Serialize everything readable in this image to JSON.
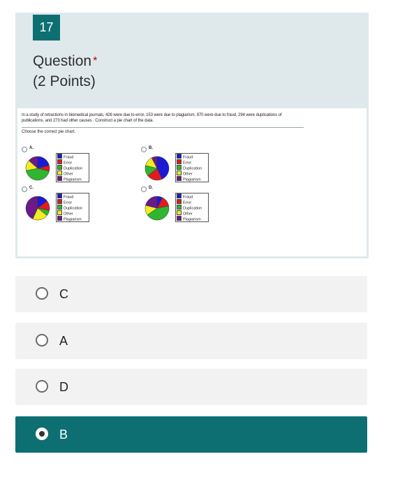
{
  "question": {
    "number": "17",
    "title": "Question",
    "required_mark": "*",
    "points": "(2 Points)"
  },
  "problem": {
    "text": "In a study of retractions in biomedical journals, 426 were due to error, 153 were due to plagiarism, 870 were due to fraud, 294 were duplications of publications, and 273 had other causes . Construct a pie chart of the data.",
    "instruction": "Choose the correct pie chart."
  },
  "legend_labels": [
    "Fraud",
    "Error",
    "Duplication",
    "Other",
    "Plagiarism"
  ],
  "colors": {
    "accent": "#0e6f73",
    "card_bg": "#dfe9ec",
    "required": "#c00000",
    "fraud": "#1a1ad6",
    "error": "#e01c1c",
    "duplication": "#2fb52f",
    "other": "#f2ec22",
    "plagiarism": "#6a1a8a"
  },
  "chart_options": [
    {
      "label": "A.",
      "slices": [
        {
          "cat": "Fraud",
          "v": 426
        },
        {
          "cat": "Error",
          "v": 153
        },
        {
          "cat": "Duplication",
          "v": 870
        },
        {
          "cat": "Other",
          "v": 294
        },
        {
          "cat": "Plagiarism",
          "v": 273
        }
      ]
    },
    {
      "label": "B.",
      "slices": [
        {
          "cat": "Fraud",
          "v": 870
        },
        {
          "cat": "Error",
          "v": 426
        },
        {
          "cat": "Duplication",
          "v": 294
        },
        {
          "cat": "Other",
          "v": 273
        },
        {
          "cat": "Plagiarism",
          "v": 153
        }
      ]
    },
    {
      "label": "C.",
      "slices": [
        {
          "cat": "Fraud",
          "v": 294
        },
        {
          "cat": "Error",
          "v": 273
        },
        {
          "cat": "Duplication",
          "v": 153
        },
        {
          "cat": "Other",
          "v": 426
        },
        {
          "cat": "Plagiarism",
          "v": 870
        }
      ]
    },
    {
      "label": "D.",
      "slices": [
        {
          "cat": "Fraud",
          "v": 153
        },
        {
          "cat": "Error",
          "v": 294
        },
        {
          "cat": "Duplication",
          "v": 870
        },
        {
          "cat": "Other",
          "v": 273
        },
        {
          "cat": "Plagiarism",
          "v": 426
        }
      ]
    }
  ],
  "answers": [
    {
      "label": "C",
      "selected": false
    },
    {
      "label": "A",
      "selected": false
    },
    {
      "label": "D",
      "selected": false
    },
    {
      "label": "B",
      "selected": true
    }
  ]
}
